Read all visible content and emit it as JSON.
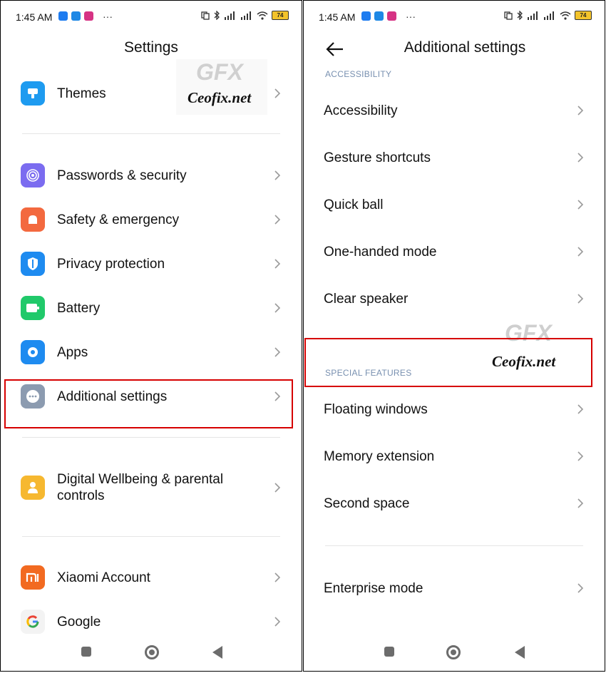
{
  "status_bar": {
    "time": "1:45 AM",
    "more": "···",
    "battery": "74"
  },
  "left": {
    "title": "Settings",
    "items": [
      {
        "label": "Themes",
        "icon": "brush-icon",
        "color": "#1e9bf0"
      },
      {
        "label": "Passwords & security",
        "icon": "fingerprint-icon",
        "color": "#7b6cf0"
      },
      {
        "label": "Safety & emergency",
        "icon": "alarm-icon",
        "color": "#f3693f"
      },
      {
        "label": "Privacy protection",
        "icon": "shield-icon",
        "color": "#1e8bf0"
      },
      {
        "label": "Battery",
        "icon": "battery-icon",
        "color": "#20c96a"
      },
      {
        "label": "Apps",
        "icon": "gear-icon",
        "color": "#1e8bf0"
      },
      {
        "label": "Additional settings",
        "icon": "more-dots-icon",
        "color": "#8c9bb0"
      },
      {
        "label": "Digital Wellbeing & parental controls",
        "icon": "person-icon",
        "color": "#f6b830"
      },
      {
        "label": "Xiaomi Account",
        "icon": "mi-logo-icon",
        "color": "#f26a21"
      },
      {
        "label": "Google",
        "icon": "google-logo-icon",
        "color": "#f3f3f3"
      }
    ]
  },
  "right": {
    "title": "Additional settings",
    "section_accessibility": "ACCESSIBILITY",
    "section_special": "SPECIAL FEATURES",
    "items": [
      "Accessibility",
      "Gesture shortcuts",
      "Quick ball",
      "One-handed mode",
      "Clear speaker",
      "Floating windows",
      "Memory extension",
      "Second space",
      "Enterprise mode"
    ]
  },
  "watermark": {
    "logo": "GFX",
    "text": "Ceofix.net"
  },
  "colors": {
    "highlight": "#d60000",
    "section": "#7890b0",
    "chevron": "#9a9a9a"
  }
}
